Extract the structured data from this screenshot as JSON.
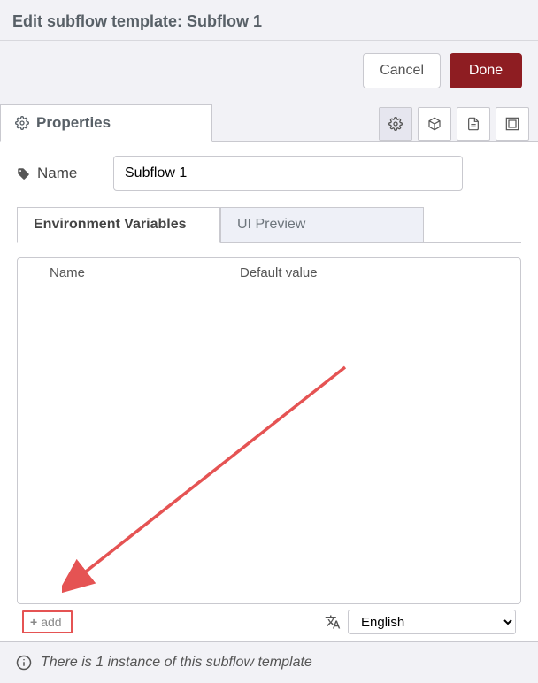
{
  "header": {
    "title": "Edit subflow template:  Subflow 1"
  },
  "buttons": {
    "cancel": "Cancel",
    "done": "Done"
  },
  "tabs": {
    "properties": "Properties"
  },
  "form": {
    "name_label": "Name",
    "name_value": "Subflow 1"
  },
  "subtabs": {
    "env": "Environment Variables",
    "ui": "UI Preview"
  },
  "env_table": {
    "col_name": "Name",
    "col_default": "Default value"
  },
  "env_footer": {
    "add_label": "add",
    "language_options": [
      "English"
    ],
    "language_selected": "English"
  },
  "footer": {
    "message": "There is 1 instance of this subflow template"
  }
}
